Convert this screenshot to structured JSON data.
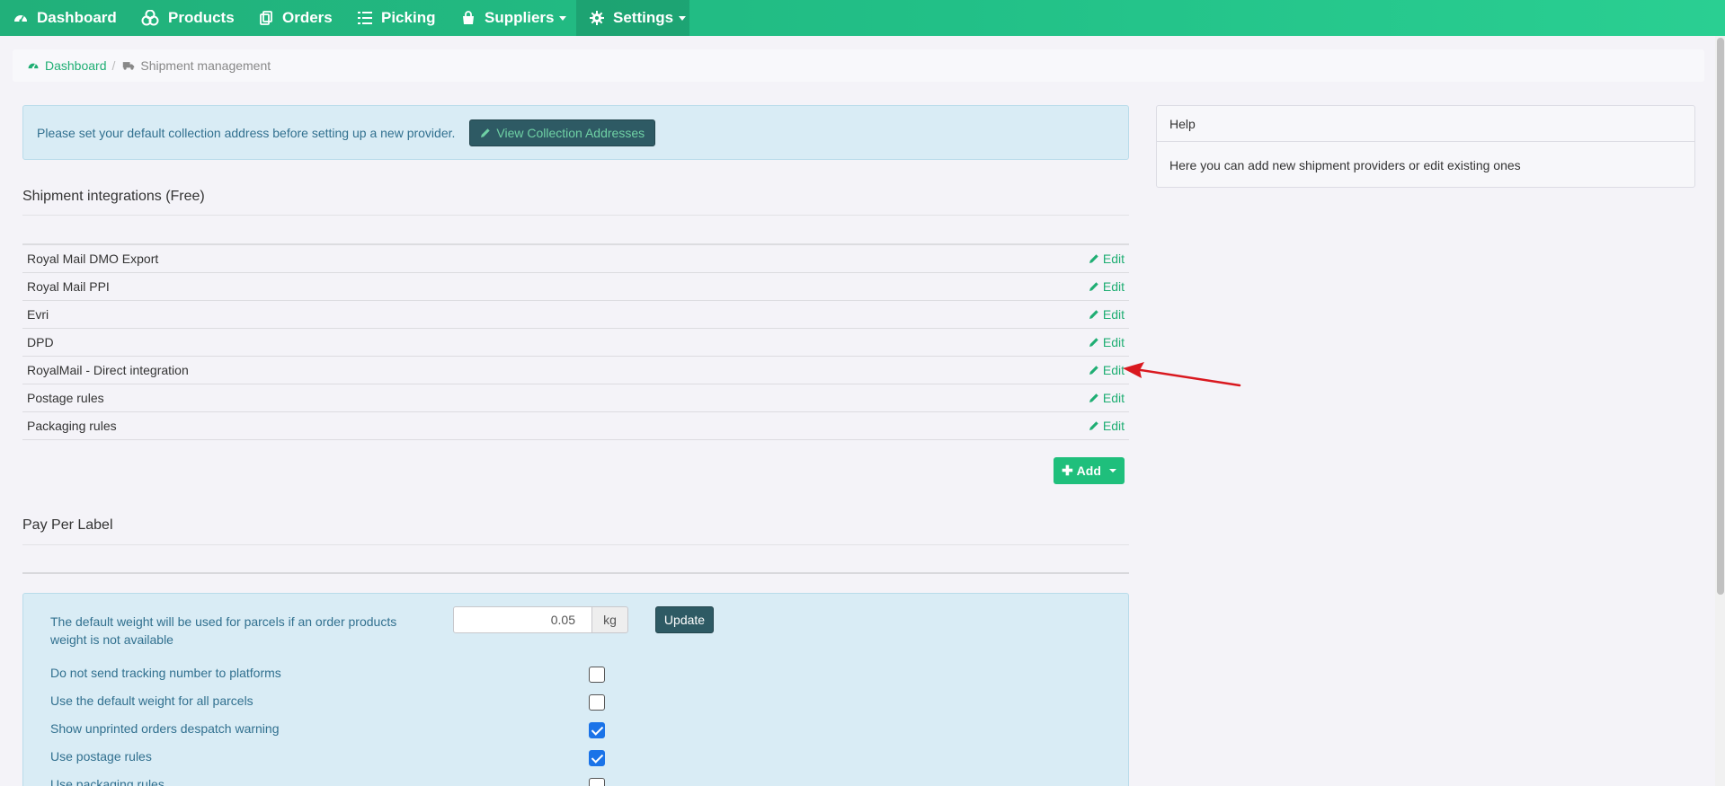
{
  "nav": {
    "items": [
      {
        "label": "Dashboard",
        "icon": "dashboard-icon"
      },
      {
        "label": "Products",
        "icon": "cubes-icon"
      },
      {
        "label": "Orders",
        "icon": "clipboard-icon"
      },
      {
        "label": "Picking",
        "icon": "list-icon"
      },
      {
        "label": "Suppliers",
        "icon": "shopping-bag-icon"
      },
      {
        "label": "Settings",
        "icon": "gear-icon"
      }
    ]
  },
  "breadcrumb": {
    "home": "Dashboard",
    "separator": "/",
    "current": "Shipment management"
  },
  "alert": {
    "message": "Please set your default collection address before setting up a new provider.",
    "button_label": "View Collection Addresses"
  },
  "integrations": {
    "title": "Shipment integrations (Free)",
    "edit_label": "Edit",
    "rows": [
      "Royal Mail DMO Export",
      "Royal Mail PPI",
      "Evri",
      "DPD",
      "RoyalMail - Direct integration",
      "Postage rules",
      "Packaging rules"
    ],
    "add_button": "Add"
  },
  "pay_per_label": {
    "title": "Pay Per Label"
  },
  "settings": {
    "default_weight_label_line1": "The default weight will be used for parcels if an order products",
    "default_weight_label_line2": "weight is not available",
    "default_weight_value": "0.05",
    "weight_unit": "kg",
    "update_button": "Update",
    "options": [
      {
        "label": "Do not send tracking number to platforms",
        "checked": false
      },
      {
        "label": "Use the default weight for all parcels",
        "checked": false
      },
      {
        "label": "Show unprinted orders despatch warning",
        "checked": true
      },
      {
        "label": "Use postage rules",
        "checked": true
      },
      {
        "label": "Use packaging rules",
        "checked": false
      }
    ]
  },
  "help": {
    "title": "Help",
    "body": "Here you can add new shipment providers or edit existing ones"
  },
  "colors": {
    "accent": "#1fae73",
    "nav_bg": "#22c087",
    "dark_button": "#2e5a64",
    "info_bg": "#d9ecf5",
    "annotation_arrow": "#d9181f"
  }
}
